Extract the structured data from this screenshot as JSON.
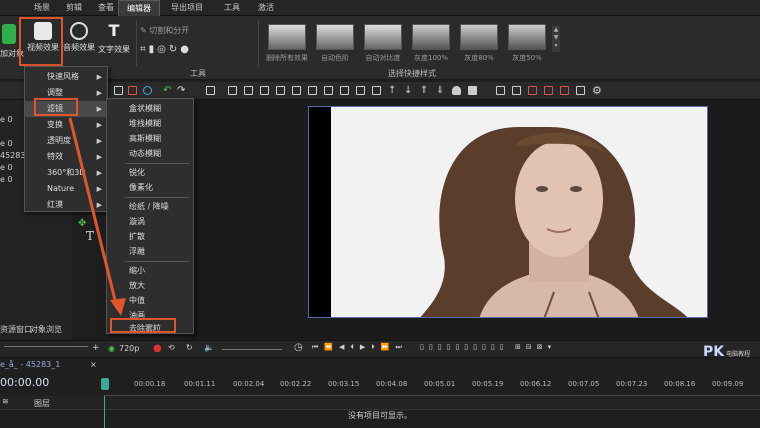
{
  "menu_tabs": [
    "场景",
    "剪辑",
    "查看",
    "编辑器",
    "导出项目",
    "工具",
    "激活"
  ],
  "ribbon": {
    "add_object_label": "添加对象",
    "video_effects_label": "视频效果",
    "audio_effects_label": "音频效果",
    "text_effects_label": "文字效果",
    "split_label": "切割和分开",
    "tools_label": "工具",
    "quick_styles_label": "选择快捷样式",
    "quick_styles": [
      "删除所有效果",
      "自动色阶",
      "自动对比度",
      "灰度100%",
      "灰度80%",
      "灰度50%"
    ]
  },
  "left_panel": {
    "lines": [
      "e 0",
      "e 0",
      "45283",
      "e 0",
      "e 0"
    ],
    "bottom_tabs": [
      "资源窗口",
      "对象浏览"
    ]
  },
  "main_menu": {
    "items": [
      "快速风格",
      "调整",
      "滤镜",
      "变换",
      "透明度",
      "特效",
      "360°和3D",
      "Nature",
      "红漠"
    ],
    "selected": "滤镜"
  },
  "filter_submenu": {
    "items": [
      "盒状模糊",
      "堆栈模糊",
      "高斯模糊",
      "动态模糊",
      "锐化",
      "像素化",
      "绘纸 / 降噪",
      "漩涡",
      "扩散",
      "浮雕",
      "缩小",
      "放大",
      "中值",
      "油画",
      "去除雾粒"
    ],
    "highlighted": "去除雾粒"
  },
  "transport": {
    "quality": "720p"
  },
  "timeline": {
    "clip_name": "e_å_ - 45283_1",
    "current_time": "00:00.00",
    "track_label": "图层",
    "ticks": [
      "00:00.18",
      "00:01.11",
      "00:02.04",
      "00:02.22",
      "00:03.15",
      "00:04.08",
      "00:05.01",
      "00:05.19",
      "00:06.12",
      "00:07.05",
      "00:07.23",
      "00:08.16",
      "00:09.09"
    ],
    "empty_message": "没有项目可显示。"
  },
  "watermark": {
    "brand": "PK",
    "sub": "电脑教程"
  },
  "colors": {
    "highlight": "#e0552a",
    "frame_border": "#5a6aa8"
  }
}
